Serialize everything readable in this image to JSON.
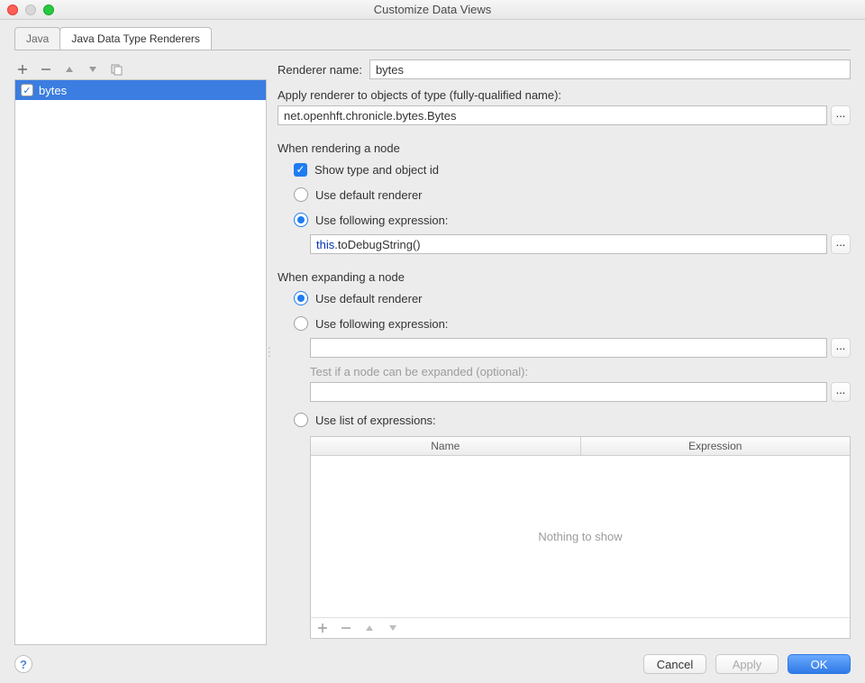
{
  "title": "Customize Data Views",
  "tabs": [
    {
      "label": "Java",
      "active": false
    },
    {
      "label": "Java Data Type Renderers",
      "active": true
    }
  ],
  "renderer_list": {
    "items": [
      {
        "label": "bytes",
        "checked": true,
        "selected": true
      }
    ]
  },
  "labels": {
    "renderer_name": "Renderer name:",
    "apply_type": "Apply renderer to objects of type (fully-qualified name):",
    "render_node_head": "When rendering a node",
    "show_type": "Show type and object id",
    "use_default_renderer": "Use default renderer",
    "use_following_expr": "Use following expression:",
    "expand_node_head": "When expanding a node",
    "test_expand": "Test if a node can be expanded (optional):",
    "use_list_expr": "Use list of expressions:",
    "col_name": "Name",
    "col_expr": "Expression",
    "nothing": "Nothing to show",
    "ellipsis": "..."
  },
  "values": {
    "renderer_name": "bytes",
    "type_fqn": "net.openhft.chronicle.bytes.Bytes",
    "render_expr_prefix": "this",
    "render_expr_suffix": ".toDebugString()",
    "expand_expr": "",
    "test_expand_expr": ""
  },
  "buttons": {
    "cancel": "Cancel",
    "apply": "Apply",
    "ok": "OK"
  }
}
